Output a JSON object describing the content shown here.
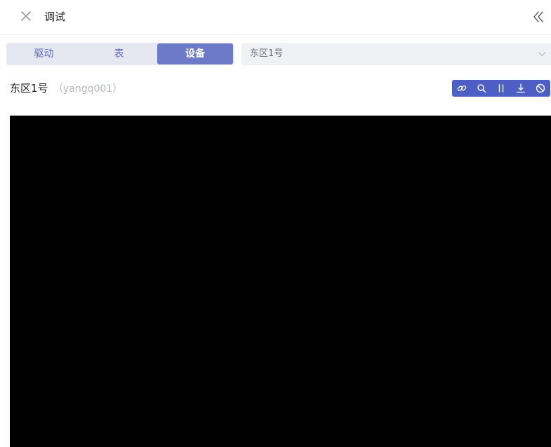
{
  "header": {
    "title": "调试",
    "close_icon": "close-icon",
    "collapse_icon": "double-chevron-left-icon"
  },
  "tabs": [
    {
      "label": "驱动",
      "active": false
    },
    {
      "label": "表",
      "active": false
    },
    {
      "label": "设备",
      "active": true
    }
  ],
  "device_select": {
    "value": "东区1号",
    "icon": "chevron-down-icon"
  },
  "device": {
    "name": "东区1号",
    "id": "（yangq001）"
  },
  "toolbar": {
    "icons": [
      "link-icon",
      "search-icon",
      "pause-icon",
      "download-icon",
      "disable-icon"
    ],
    "color": "#4d5ec4"
  },
  "colors": {
    "active_tab": "#6c7ac8",
    "tab_text": "#5763c2",
    "video_bg": "#000000"
  }
}
